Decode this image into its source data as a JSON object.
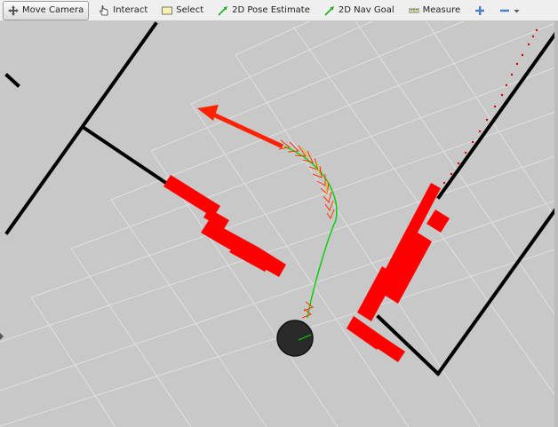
{
  "toolbar": {
    "move_camera": "Move Camera",
    "interact": "Interact",
    "select": "Select",
    "pose_estimate": "2D Pose Estimate",
    "nav_goal": "2D Nav Goal",
    "measure": "Measure",
    "active_tool": "Move Camera"
  },
  "viewport": {
    "background_color": "#c8c8c8",
    "grid_color": "#e0e0e0",
    "wall_color": "#000000",
    "obstacle_color": "#ff0000",
    "path_color": "#00d000",
    "robot_color": "#2a2a2a"
  }
}
